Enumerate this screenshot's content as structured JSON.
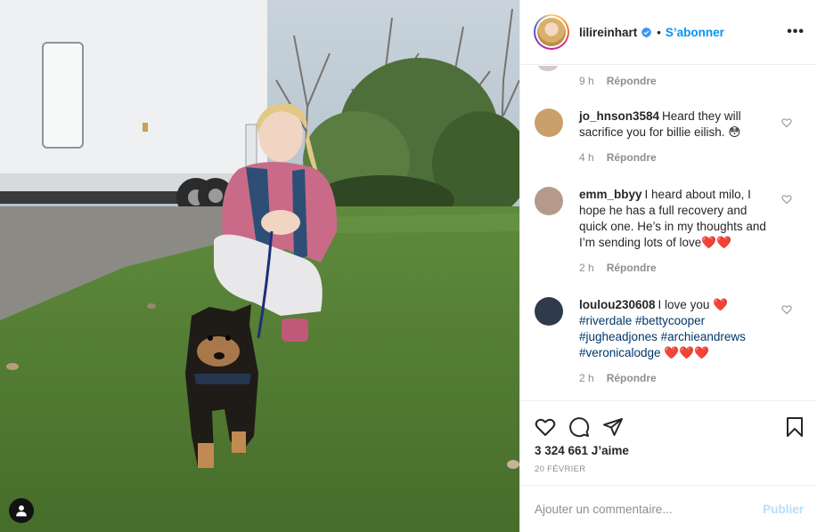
{
  "header": {
    "username": "lilireinhart",
    "separator": "•",
    "follow_label": "S’abonner",
    "more_label": "•••"
  },
  "comments_top_meta": {
    "time": "9 h",
    "reply": "Répondre"
  },
  "comments": [
    {
      "username": "jo_hnson3584",
      "text": "Heard they will sacrifice you for billie eilish. 😳",
      "time": "4 h",
      "reply": "Répondre",
      "avatar_color": "#c9a06b"
    },
    {
      "username": "emm_bbyy",
      "text": "I heard about milo, I hope he has a full recovery and quick one. He’s in my thoughts and I’m sending lots of love❤️❤️",
      "time": "2 h",
      "reply": "Répondre",
      "avatar_color": "#b59a8c"
    },
    {
      "username": "loulou230608",
      "text_start": "I love you ❤️",
      "tags": [
        "#riverdale",
        "#bettycooper",
        "#jugheadjones",
        "#archieandrews",
        "#veronicalodge"
      ],
      "text_end": "❤️❤️❤️",
      "time": "2 h",
      "reply": "Répondre",
      "avatar_color": "#2f3a4a"
    }
  ],
  "actions": {
    "likes": "3 324 661 J’aime",
    "date": "20 février"
  },
  "add_comment": {
    "placeholder": "Ajouter un commentaire...",
    "publish_label": "Publier"
  },
  "colors": {
    "accent": "#0095f6",
    "publish_disabled": "#b2dffc",
    "secondary_text": "#8e8e8e",
    "hashtag": "#00376b"
  },
  "icons": [
    "verified-badge-icon",
    "more-options-icon",
    "heart-icon",
    "comment-icon",
    "share-icon",
    "save-icon",
    "user-tag-icon"
  ]
}
